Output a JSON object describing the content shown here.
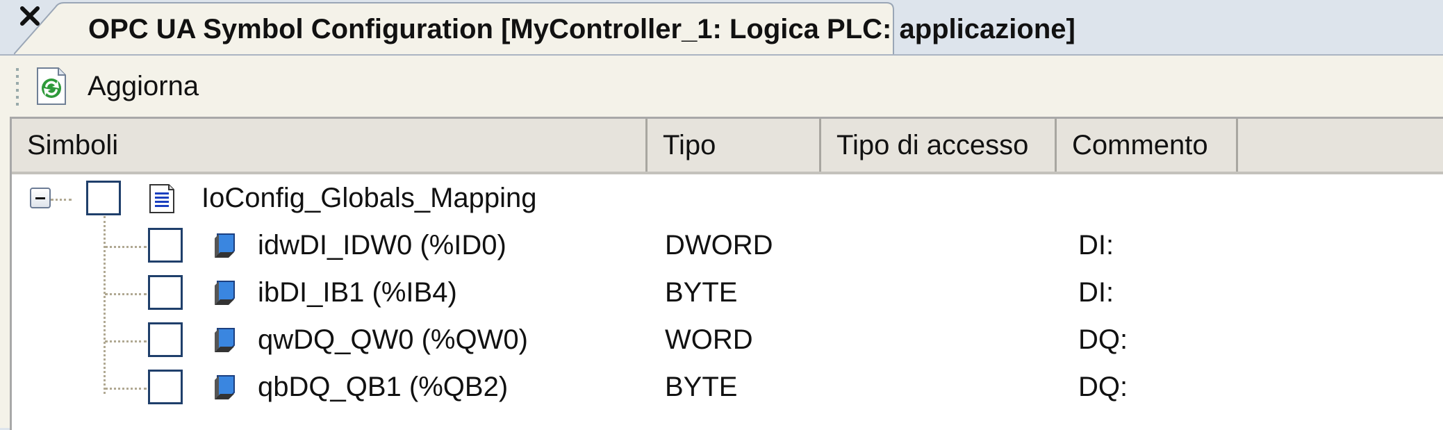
{
  "tab": {
    "title": "OPC UA Symbol Configuration [MyController_1: Logica PLC: applicazione]",
    "close_glyph": "✕"
  },
  "toolbar": {
    "refresh_label": "Aggiorna",
    "refresh_icon": "refresh-icon"
  },
  "table": {
    "columns": [
      "Simboli",
      "Tipo",
      "Tipo di accesso",
      "Commento"
    ],
    "root": {
      "label": "IoConfig_Globals_Mapping",
      "icon": "document-icon",
      "expanded": true,
      "checked": false
    },
    "rows": [
      {
        "symbol": "idwDI_IDW0 (%ID0)",
        "type": "DWORD",
        "access": "",
        "comment": "DI:",
        "checked": false,
        "icon": "variable-icon"
      },
      {
        "symbol": "ibDI_IB1 (%IB4)",
        "type": "BYTE",
        "access": "",
        "comment": "DI:",
        "checked": false,
        "icon": "variable-icon"
      },
      {
        "symbol": "qwDQ_QW0 (%QW0)",
        "type": "WORD",
        "access": "",
        "comment": "DQ:",
        "checked": false,
        "icon": "variable-icon"
      },
      {
        "symbol": "qbDQ_QB1 (%QB2)",
        "type": "BYTE",
        "access": "",
        "comment": "DQ:",
        "checked": false,
        "icon": "variable-icon"
      }
    ]
  },
  "colors": {
    "background": "#dde4ec",
    "panel": "#f4f2e9",
    "header": "#e6e3dc",
    "checkbox_border": "#1f3f6b"
  }
}
